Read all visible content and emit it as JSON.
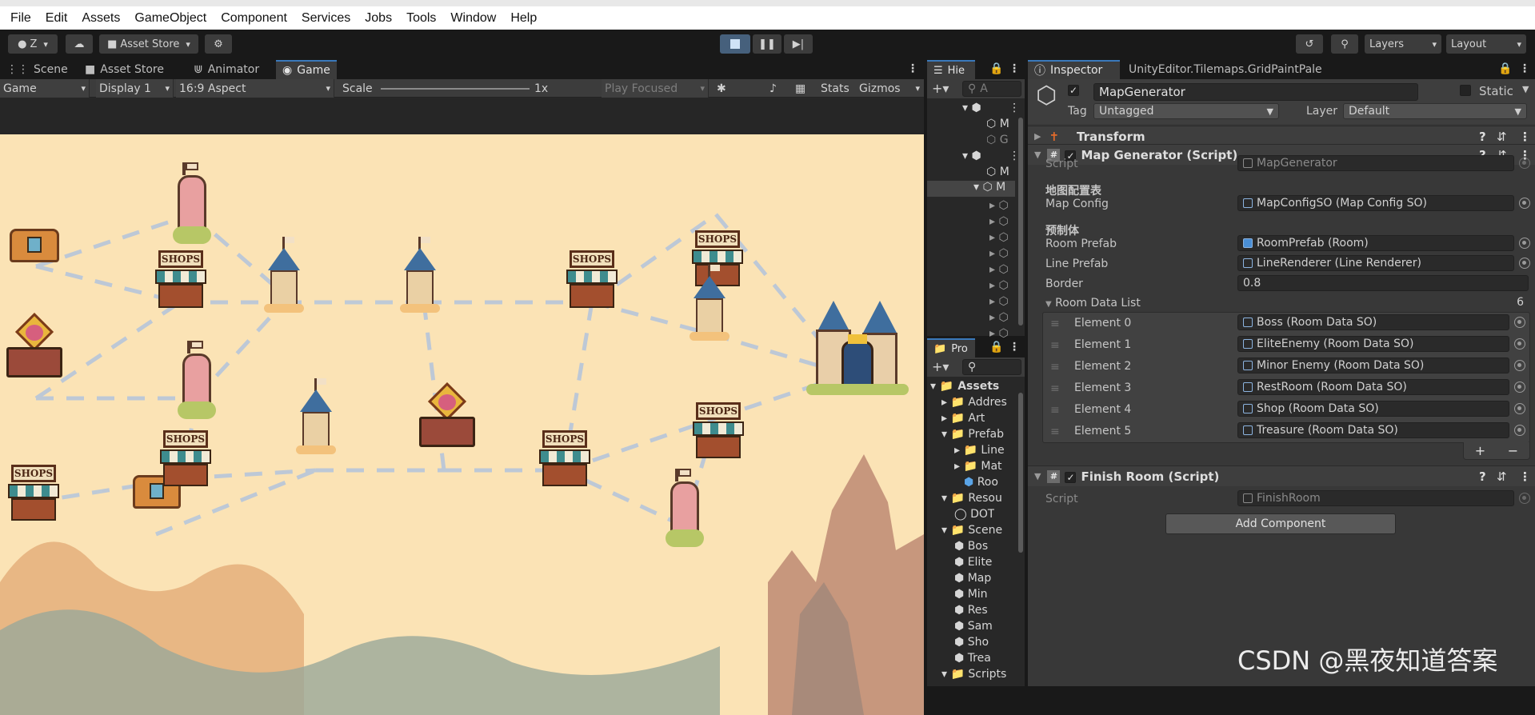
{
  "menu": [
    "File",
    "Edit",
    "Assets",
    "GameObject",
    "Component",
    "Services",
    "Jobs",
    "Tools",
    "Window",
    "Help"
  ],
  "toolbar": {
    "account_label": "Z",
    "asset_store_label": "Asset Store",
    "layers_label": "Layers",
    "layout_label": "Layout"
  },
  "game_tabs": [
    "Scene",
    "Asset Store",
    "Animator",
    "Game"
  ],
  "game_bar": {
    "view": "Game",
    "display": "Display 1",
    "aspect": "16:9 Aspect",
    "scale_label": "Scale",
    "scale_value": "1x",
    "play_mode": "Play Focused",
    "stats": "Stats",
    "gizmos": "Gizmos"
  },
  "map": {
    "shops_label": "SHOPS"
  },
  "hierarchy": {
    "tab": "Hie",
    "search_placeholder": "A",
    "rows": [
      "M",
      "G",
      "M",
      "M"
    ]
  },
  "project": {
    "tab": "Pro",
    "items": [
      "Assets",
      "Addres",
      "Art",
      "Prefab",
      "Line",
      "Mat",
      "Roo",
      "Resou",
      "DOT",
      "Scene",
      "Bos",
      "Elite",
      "Map",
      "Min",
      "Res",
      "Sam",
      "Sho",
      "Trea",
      "Scripts"
    ]
  },
  "inspector": {
    "tab": "Inspector",
    "tab2": "UnityEditor.Tilemaps.GridPaintPale",
    "object_name": "MapGenerator",
    "static_label": "Static",
    "tag_label": "Tag",
    "tag_value": "Untagged",
    "layer_label": "Layer",
    "layer_value": "Default",
    "transform": "Transform",
    "map_generator": "Map Generator (Script)",
    "script_label": "Script",
    "script_value": "MapGenerator",
    "section_map_config": "地图配置表",
    "map_config_label": "Map Config",
    "map_config_value": "MapConfigSO (Map Config SO)",
    "section_prefab": "预制体",
    "room_prefab_label": "Room Prefab",
    "room_prefab_value": "RoomPrefab (Room)",
    "line_prefab_label": "Line Prefab",
    "line_prefab_value": "LineRenderer (Line Renderer)",
    "border_label": "Border",
    "border_value": "0.8",
    "room_data_list_label": "Room Data List",
    "room_data_count": "6",
    "elements": [
      {
        "label": "Element 0",
        "value": "Boss (Room Data SO)"
      },
      {
        "label": "Element 1",
        "value": "EliteEnemy (Room Data SO)"
      },
      {
        "label": "Element 2",
        "value": "Minor Enemy (Room Data SO)"
      },
      {
        "label": "Element 3",
        "value": "RestRoom (Room Data SO)"
      },
      {
        "label": "Element 4",
        "value": "Shop (Room Data SO)"
      },
      {
        "label": "Element 5",
        "value": "Treasure (Room Data SO)"
      }
    ],
    "finish_room": "Finish Room (Script)",
    "finish_script_value": "FinishRoom",
    "add_component": "Add Component"
  },
  "watermark": "CSDN @黑夜知道答案",
  "colors": {
    "accent": "#3a79bb",
    "sky": "#fbe3b5",
    "panel": "#383838"
  }
}
